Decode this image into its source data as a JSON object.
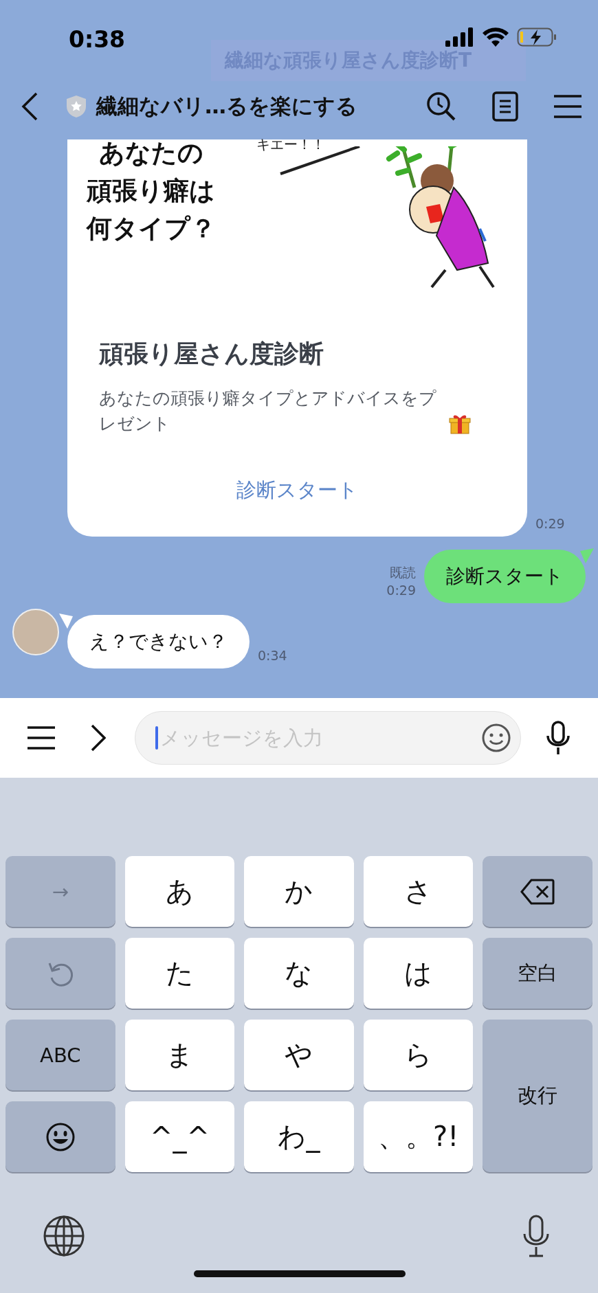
{
  "status_bar": {
    "time": "0:38"
  },
  "pinned_banner": {
    "text": "繊細な頑張り屋さん度診断T"
  },
  "nav": {
    "title": "繊細なバリ…るを楽にする"
  },
  "messages": [
    {
      "kind": "card",
      "image_text": [
        "あなたの",
        "頑張り癖は",
        "何タイプ？"
      ],
      "image_caption": "キエー！！",
      "title": "頑張り屋さん度診断",
      "description": "あなたの頑張り癖タイプとアドバイスをプレゼント",
      "action": "診断スタート",
      "time": "0:29"
    },
    {
      "kind": "sent",
      "text": "診断スタート",
      "read": "既読",
      "time": "0:29"
    },
    {
      "kind": "received",
      "text": "え？できない？",
      "time": "0:34"
    }
  ],
  "input": {
    "placeholder": "メッセージを入力"
  },
  "keyboard": {
    "keys": [
      {
        "kind": "function",
        "label": "→",
        "disabled": true
      },
      {
        "kind": "char",
        "label": "あ",
        "disabled": false
      },
      {
        "kind": "char",
        "label": "か",
        "disabled": false
      },
      {
        "kind": "char",
        "label": "さ",
        "disabled": false
      },
      {
        "kind": "backspace",
        "disabled": false
      },
      {
        "kind": "undo",
        "disabled": true
      },
      {
        "kind": "char",
        "label": "た",
        "disabled": false
      },
      {
        "kind": "char",
        "label": "な",
        "disabled": false
      },
      {
        "kind": "char",
        "label": "は",
        "disabled": false
      },
      {
        "kind": "function",
        "label": "空白",
        "disabled": false
      },
      {
        "kind": "function",
        "label": "ABC",
        "disabled": false
      },
      {
        "kind": "char",
        "label": "ま",
        "disabled": false
      },
      {
        "kind": "char",
        "label": "や",
        "disabled": false
      },
      {
        "kind": "char",
        "label": "ら",
        "disabled": false
      },
      {
        "kind": "return",
        "label": "改行",
        "disabled": false
      },
      {
        "kind": "emoji",
        "disabled": false
      },
      {
        "kind": "char",
        "label": "^_^",
        "disabled": false
      },
      {
        "kind": "char",
        "label": "わ_",
        "disabled": false
      },
      {
        "kind": "char",
        "label": "、。?!",
        "disabled": false
      }
    ]
  }
}
